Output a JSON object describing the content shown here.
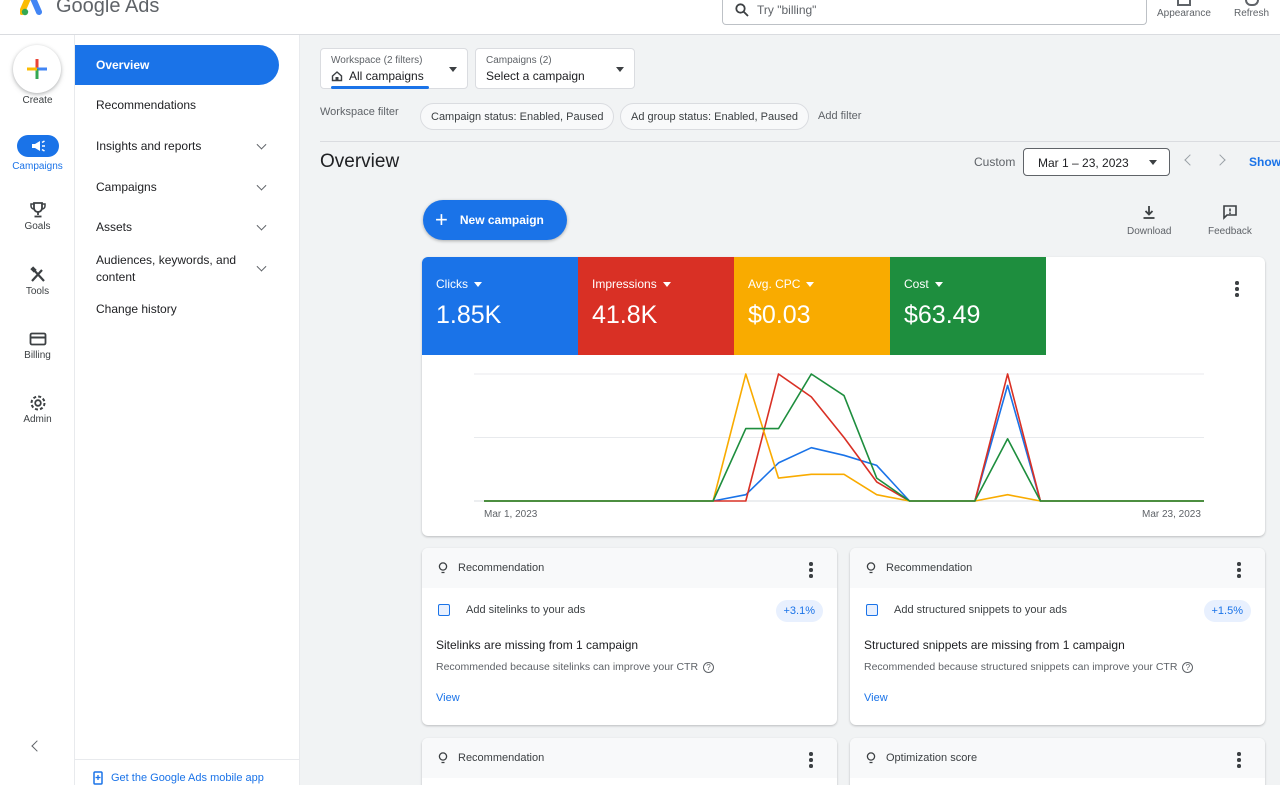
{
  "app": {
    "name": "Google Ads"
  },
  "search": {
    "placeholder": "Try \"billing\""
  },
  "top_actions": {
    "appearance": "Appearance",
    "refresh": "Refresh"
  },
  "rail": {
    "create": "Create",
    "items": [
      {
        "label": "Campaigns",
        "icon": "megaphone-icon",
        "active": true
      },
      {
        "label": "Goals",
        "icon": "trophy-icon"
      },
      {
        "label": "Tools",
        "icon": "tools-icon"
      },
      {
        "label": "Billing",
        "icon": "credit-card-icon"
      },
      {
        "label": "Admin",
        "icon": "gear-icon"
      }
    ]
  },
  "sidenav": {
    "items": [
      {
        "label": "Overview",
        "active": true
      },
      {
        "label": "Recommendations"
      },
      {
        "label": "Insights and reports",
        "expandable": true
      },
      {
        "label": "Campaigns",
        "expandable": true
      },
      {
        "label": "Assets",
        "expandable": true
      },
      {
        "label": "Audiences, keywords, and content",
        "expandable": true
      },
      {
        "label": "Change history"
      }
    ],
    "mobile_link": "Get the Google Ads mobile app"
  },
  "workspace": {
    "label": "Workspace (2 filters)",
    "value": "All campaigns"
  },
  "campaigns_dd": {
    "label": "Campaigns (2)",
    "value": "Select a campaign"
  },
  "filters": {
    "label": "Workspace filter",
    "chips": [
      "Campaign status: Enabled, Paused",
      "Ad group status: Enabled, Paused"
    ],
    "add": "Add filter"
  },
  "page": {
    "title": "Overview",
    "date_label": "Custom",
    "date_range": "Mar 1 – 23, 2023",
    "show": "Show"
  },
  "actions": {
    "new_campaign": "New campaign",
    "download": "Download",
    "feedback": "Feedback"
  },
  "metrics": [
    {
      "label": "Clicks",
      "value": "1.85K",
      "color": "#1a73e8"
    },
    {
      "label": "Impressions",
      "value": "41.8K",
      "color": "#d93025"
    },
    {
      "label": "Avg. CPC",
      "value": "$0.03",
      "color": "#f9ab00"
    },
    {
      "label": "Cost",
      "value": "$63.49",
      "color": "#1e8e3e"
    }
  ],
  "chart_data": {
    "type": "line",
    "x": [
      "Mar 1",
      "Mar 2",
      "Mar 3",
      "Mar 4",
      "Mar 5",
      "Mar 6",
      "Mar 7",
      "Mar 8",
      "Mar 9",
      "Mar 10",
      "Mar 11",
      "Mar 12",
      "Mar 13",
      "Mar 14",
      "Mar 15",
      "Mar 16",
      "Mar 17",
      "Mar 18",
      "Mar 19",
      "Mar 20",
      "Mar 21",
      "Mar 22",
      "Mar 23"
    ],
    "tick_labels": [
      "Mar 1, 2023",
      "Mar 23, 2023"
    ],
    "ylim": [
      0,
      100
    ],
    "grid": true,
    "series": [
      {
        "name": "Clicks",
        "color": "#1a73e8",
        "values": [
          0,
          0,
          0,
          0,
          0,
          0,
          0,
          0,
          5,
          30,
          42,
          36,
          28,
          0,
          0,
          0,
          91,
          0,
          0,
          0,
          0,
          0,
          0
        ]
      },
      {
        "name": "Impressions",
        "color": "#d93025",
        "values": [
          0,
          0,
          0,
          0,
          0,
          0,
          0,
          0,
          0,
          100,
          82,
          50,
          15,
          0,
          0,
          0,
          100,
          0,
          0,
          0,
          0,
          0,
          0
        ]
      },
      {
        "name": "Avg. CPC",
        "color": "#f9ab00",
        "values": [
          0,
          0,
          0,
          0,
          0,
          0,
          0,
          0,
          100,
          18,
          21,
          21,
          5,
          0,
          0,
          0,
          5,
          0,
          0,
          0,
          0,
          0,
          0
        ]
      },
      {
        "name": "Cost",
        "color": "#1e8e3e",
        "values": [
          0,
          0,
          0,
          0,
          0,
          0,
          0,
          0,
          57,
          57,
          100,
          83,
          18,
          0,
          0,
          0,
          49,
          0,
          0,
          0,
          0,
          0,
          0
        ]
      }
    ]
  },
  "recommendations": [
    {
      "header": "Recommendation",
      "sub": "Add sitelinks to your ads",
      "badge": "+3.1%",
      "title": "Sitelinks are missing from 1 campaign",
      "desc": "Recommended because sitelinks can improve your CTR",
      "view": "View"
    },
    {
      "header": "Recommendation",
      "sub": "Add structured snippets to your ads",
      "badge": "+1.5%",
      "title": "Structured snippets are missing from 1 campaign",
      "desc": "Recommended because structured snippets can improve your CTR",
      "view": "View"
    },
    {
      "header": "Recommendation"
    },
    {
      "header": "Optimization score"
    }
  ]
}
